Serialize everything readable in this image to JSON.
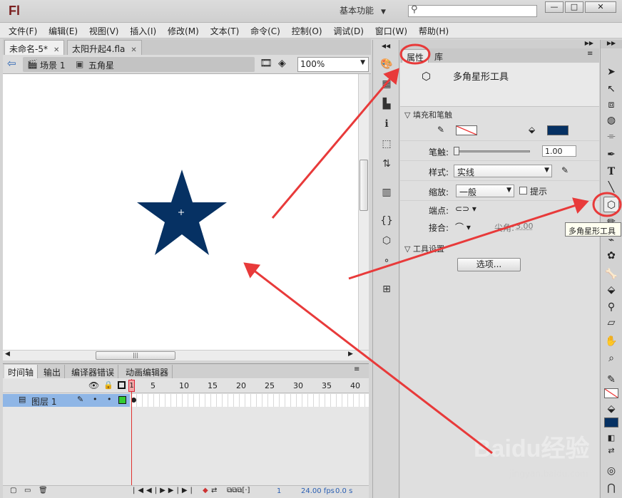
{
  "app": {
    "logo": "Fl",
    "workspace": "基本功能",
    "search_placeholder": ""
  },
  "window_buttons": [
    "—",
    "□",
    "✕"
  ],
  "menu": [
    "文件(F)",
    "编辑(E)",
    "视图(V)",
    "插入(I)",
    "修改(M)",
    "文本(T)",
    "命令(C)",
    "控制(O)",
    "调试(D)",
    "窗口(W)",
    "帮助(H)"
  ],
  "doc_tabs": [
    {
      "label": "未命名-5*",
      "active": true
    },
    {
      "label": "太阳升起4.fla",
      "active": false
    }
  ],
  "editbar": {
    "scene": "场景 1",
    "symbol": "五角星",
    "zoom": "100%"
  },
  "stage": {
    "star_color": "#063163"
  },
  "timeline": {
    "tabs": [
      "时间轴",
      "输出",
      "编译器错误",
      "动画编辑器"
    ],
    "layer_name": "图层 1",
    "frame_numbers": [
      "1",
      "5",
      "10",
      "15",
      "20",
      "25",
      "30",
      "35",
      "40"
    ],
    "status": {
      "frame": "1",
      "fps": "24.00 fps",
      "time": "0.0 s"
    }
  },
  "properties": {
    "tabs": [
      "属性",
      "库"
    ],
    "tool_name": "多角星形工具",
    "fill_stroke_header": "填充和笔触",
    "stroke_label": "笔触:",
    "stroke_value": "1.00",
    "style_label": "样式:",
    "style_value": "实线",
    "scale_label": "缩放:",
    "scale_value": "一般",
    "hint_label": "提示",
    "cap_label": "端点:",
    "join_label": "接合:",
    "miter_label": "尖角:",
    "miter_value": "3.00",
    "tool_settings_header": "工具设置",
    "options_button": "选项...",
    "fill_color": "#063163"
  },
  "tooltip": "多角星形工具",
  "watermark": {
    "main": "Baidu经验",
    "sub": "jingyan.baidu.com"
  },
  "annotation_color": "#e83a3a"
}
